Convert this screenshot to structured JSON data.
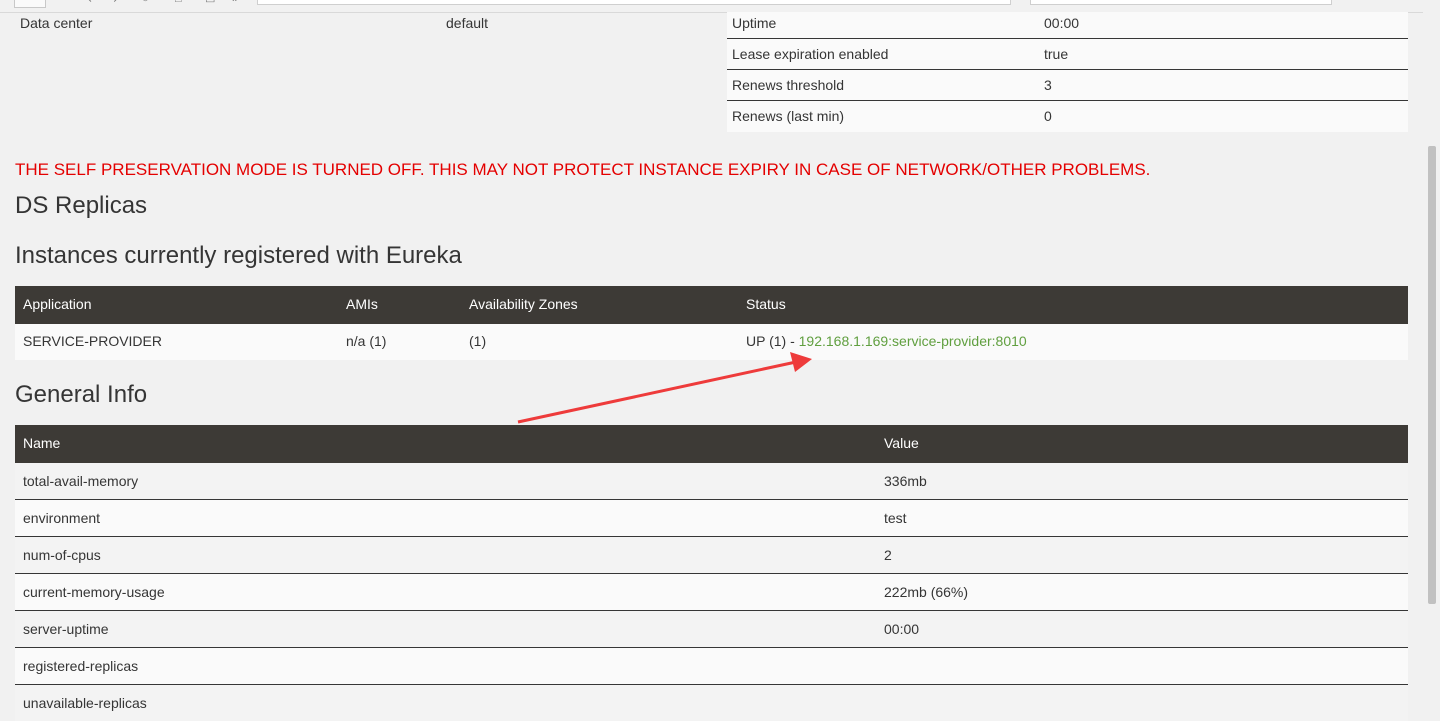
{
  "system_status": {
    "left": [
      {
        "key": "Data center",
        "value": "default"
      }
    ],
    "right": [
      {
        "key": "Uptime",
        "value": "00:00"
      },
      {
        "key": "Lease expiration enabled",
        "value": "true"
      },
      {
        "key": "Renews threshold",
        "value": "3"
      },
      {
        "key": "Renews (last min)",
        "value": "0"
      }
    ]
  },
  "warning": "THE SELF PRESERVATION MODE IS TURNED OFF. THIS MAY NOT PROTECT INSTANCE EXPIRY IN CASE OF NETWORK/OTHER PROBLEMS.",
  "ds_replicas_title": "DS Replicas",
  "instances": {
    "title": "Instances currently registered with Eureka",
    "headers": [
      "Application",
      "AMIs",
      "Availability Zones",
      "Status"
    ],
    "rows": [
      {
        "application": "SERVICE-PROVIDER",
        "amis": "n/a (1)",
        "zones": "(1)",
        "status_prefix": "UP (1) - ",
        "status_link": "192.168.1.169:service-provider:8010"
      }
    ]
  },
  "general_info": {
    "title": "General Info",
    "headers": [
      "Name",
      "Value"
    ],
    "rows": [
      {
        "name": "total-avail-memory",
        "value": "336mb"
      },
      {
        "name": "environment",
        "value": "test"
      },
      {
        "name": "num-of-cpus",
        "value": "2"
      },
      {
        "name": "current-memory-usage",
        "value": "222mb (66%)"
      },
      {
        "name": "server-uptime",
        "value": "00:00"
      },
      {
        "name": "registered-replicas",
        "value": ""
      },
      {
        "name": "unavailable-replicas",
        "value": ""
      }
    ]
  },
  "colors": {
    "header_bg": "#3d3a36",
    "warning": "#e40000",
    "link": "#609f3f",
    "annotation_arrow": "#ee3b3b"
  }
}
